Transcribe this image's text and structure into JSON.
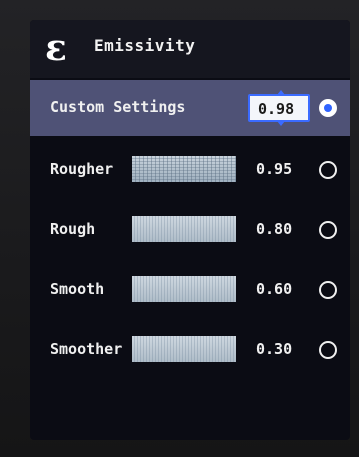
{
  "header": {
    "icon": "epsilon-icon",
    "icon_glyph": "ε",
    "title": "Emissivity"
  },
  "options": [
    {
      "label": "Custom Settings",
      "value": "0.98",
      "selected": true
    },
    {
      "label": "Rougher",
      "value": "0.95",
      "selected": false
    },
    {
      "label": "Rough",
      "value": "0.80",
      "selected": false
    },
    {
      "label": "Smooth",
      "value": "0.60",
      "selected": false
    },
    {
      "label": "Smoother",
      "value": "0.30",
      "selected": false
    }
  ],
  "colors": {
    "selected_row": "#4f5276",
    "accent": "#3b6bff",
    "background": "#0b0c14"
  }
}
